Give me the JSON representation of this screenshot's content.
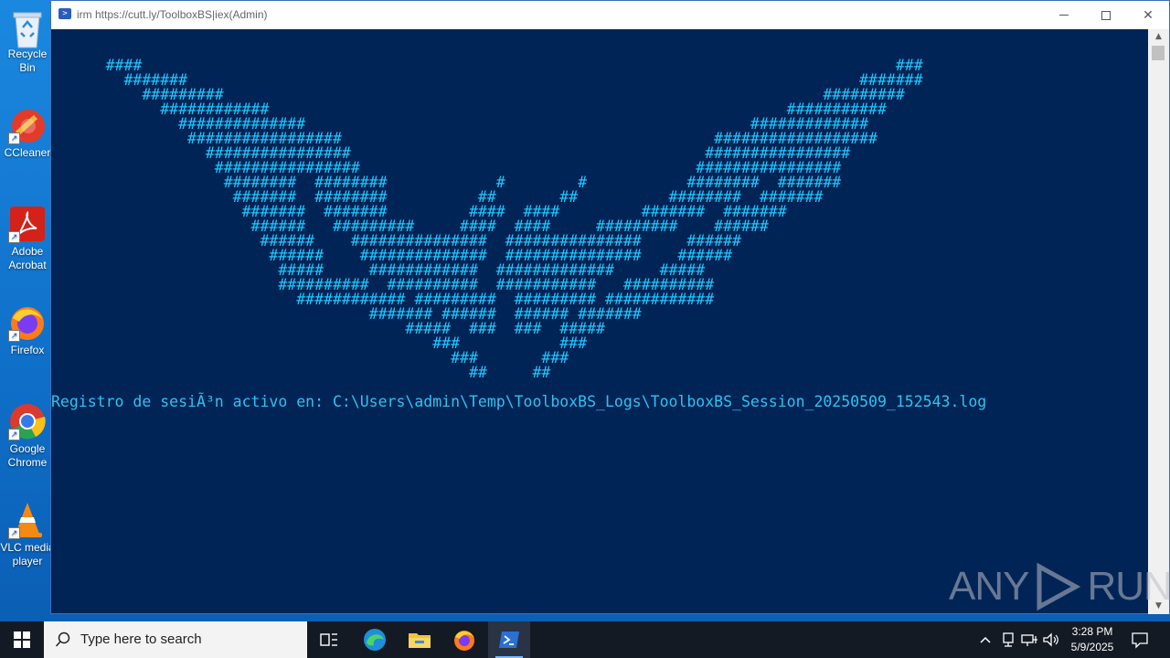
{
  "window": {
    "title": "irm https://cutt.ly/ToolboxBS|iex(Admin)",
    "controls": {
      "minimize": "minimize-icon",
      "maximize": "maximize-icon",
      "close": "close-icon"
    }
  },
  "console": {
    "ascii_art": "      ####                                                                                   ###\n        #######                                                                          #######\n          #########                                                                  #########\n            ############                                                         ###########\n              ##############                                                 #############\n               #################                                         ##################\n                 ################                                       ################\n                  ################                                     ################\n                   ########  ########            #        #           ########  #######\n                    #######  ########          ##       ##          ########  #######\n                     #######  #######         ####  ####         #######  #######\n                      ######   #########     ####  ####     #########    ######\n                       ######    ###############  ###############     ######\n                        ######    ##############  ###############    ######\n                         #####     ############  #############     #####\n                         ##########  ##########  ###########   ##########\n                           ############ #########  ######### ############\n                                   ####### ######  ###### #######\n                                       #####  ###  ###  #####\n                                          ###           ###\n                                            ###       ###\n                                              ##     ##",
    "log_line": "Registro de sesiÃ³n activo en: C:\\Users\\admin\\Temp\\ToolboxBS_Logs\\ToolboxBS_Session_20250509_152543.log"
  },
  "desktop_icons": [
    {
      "label": "Recycle Bin",
      "icon": "recycle-bin-icon"
    },
    {
      "label": "CCleaner",
      "icon": "ccleaner-icon"
    },
    {
      "label": "Adobe\nAcrobat",
      "icon": "adobe-acrobat-icon"
    },
    {
      "label": "Firefox",
      "icon": "firefox-icon"
    },
    {
      "label": "Google\nChrome",
      "icon": "chrome-icon"
    },
    {
      "label": "VLC media\nplayer",
      "icon": "vlc-icon"
    }
  ],
  "watermark": {
    "left": "ANY",
    "right": "RUN"
  },
  "taskbar": {
    "search_placeholder": "Type here to search",
    "apps": [
      "task-view-icon",
      "edge-icon",
      "file-explorer-icon",
      "firefox-icon",
      "powershell-icon"
    ],
    "tray_icons": [
      "chevron-up-icon",
      "network-icon",
      "wifi-icon",
      "volume-icon",
      "notification-icon"
    ],
    "time": "3:28 PM",
    "date": "5/9/2025"
  },
  "colors": {
    "console_bg": "#012456",
    "console_text": "#1ec8ff",
    "taskbar": "#141a24",
    "desktop": "#1b88e0"
  }
}
